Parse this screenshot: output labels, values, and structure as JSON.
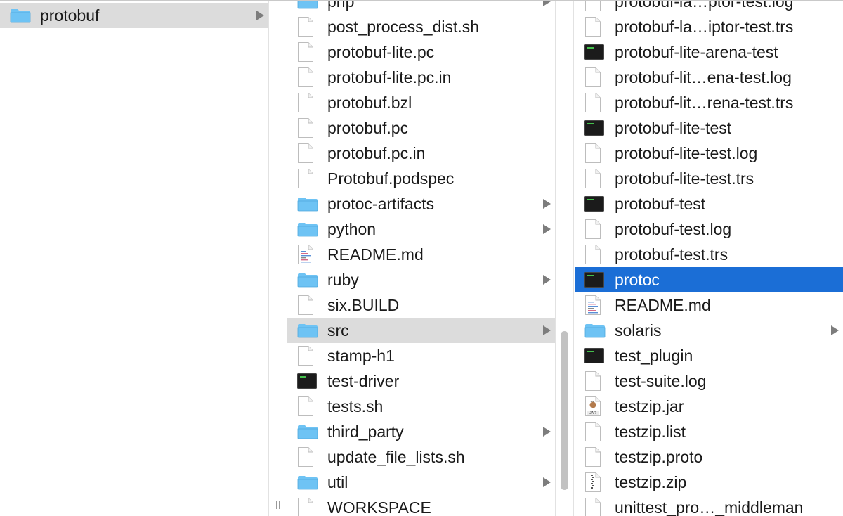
{
  "columns": [
    {
      "items": [
        {
          "name": "protobuf",
          "type": "folder",
          "has_children": true,
          "selected": "gray"
        }
      ]
    },
    {
      "items": [
        {
          "name": "php",
          "type": "folder",
          "has_children": true
        },
        {
          "name": "post_process_dist.sh",
          "type": "doc"
        },
        {
          "name": "protobuf-lite.pc",
          "type": "doc"
        },
        {
          "name": "protobuf-lite.pc.in",
          "type": "doc"
        },
        {
          "name": "protobuf.bzl",
          "type": "doc"
        },
        {
          "name": "protobuf.pc",
          "type": "doc"
        },
        {
          "name": "protobuf.pc.in",
          "type": "doc"
        },
        {
          "name": "Protobuf.podspec",
          "type": "doc"
        },
        {
          "name": "protoc-artifacts",
          "type": "folder",
          "has_children": true
        },
        {
          "name": "python",
          "type": "folder",
          "has_children": true
        },
        {
          "name": "README.md",
          "type": "text"
        },
        {
          "name": "ruby",
          "type": "folder",
          "has_children": true
        },
        {
          "name": "six.BUILD",
          "type": "doc"
        },
        {
          "name": "src",
          "type": "folder",
          "has_children": true,
          "selected": "gray"
        },
        {
          "name": "stamp-h1",
          "type": "doc"
        },
        {
          "name": "test-driver",
          "type": "exec"
        },
        {
          "name": "tests.sh",
          "type": "doc"
        },
        {
          "name": "third_party",
          "type": "folder",
          "has_children": true
        },
        {
          "name": "update_file_lists.sh",
          "type": "doc"
        },
        {
          "name": "util",
          "type": "folder",
          "has_children": true
        },
        {
          "name": "WORKSPACE",
          "type": "doc"
        }
      ]
    },
    {
      "items": [
        {
          "name": "protobuf-la…ptor-test.log",
          "type": "doc"
        },
        {
          "name": "protobuf-la…iptor-test.trs",
          "type": "doc"
        },
        {
          "name": "protobuf-lite-arena-test",
          "type": "exec"
        },
        {
          "name": "protobuf-lit…ena-test.log",
          "type": "doc"
        },
        {
          "name": "protobuf-lit…rena-test.trs",
          "type": "doc"
        },
        {
          "name": "protobuf-lite-test",
          "type": "exec"
        },
        {
          "name": "protobuf-lite-test.log",
          "type": "doc"
        },
        {
          "name": "protobuf-lite-test.trs",
          "type": "doc"
        },
        {
          "name": "protobuf-test",
          "type": "exec"
        },
        {
          "name": "protobuf-test.log",
          "type": "doc"
        },
        {
          "name": "protobuf-test.trs",
          "type": "doc"
        },
        {
          "name": "protoc",
          "type": "exec",
          "selected": "blue"
        },
        {
          "name": "README.md",
          "type": "text"
        },
        {
          "name": "solaris",
          "type": "folder",
          "has_children": true
        },
        {
          "name": "test_plugin",
          "type": "exec"
        },
        {
          "name": "test-suite.log",
          "type": "doc"
        },
        {
          "name": "testzip.jar",
          "type": "jar",
          "badge": "JAR"
        },
        {
          "name": "testzip.list",
          "type": "doc"
        },
        {
          "name": "testzip.proto",
          "type": "doc"
        },
        {
          "name": "testzip.zip",
          "type": "zip"
        },
        {
          "name": "unittest_pro…_middleman",
          "type": "doc"
        }
      ]
    }
  ],
  "colors": {
    "folder": "#6ec3f4",
    "selection_active": "#1b6ed6",
    "selection_inactive": "#dcdcdc",
    "exec_icon": "#1b1b1b"
  }
}
